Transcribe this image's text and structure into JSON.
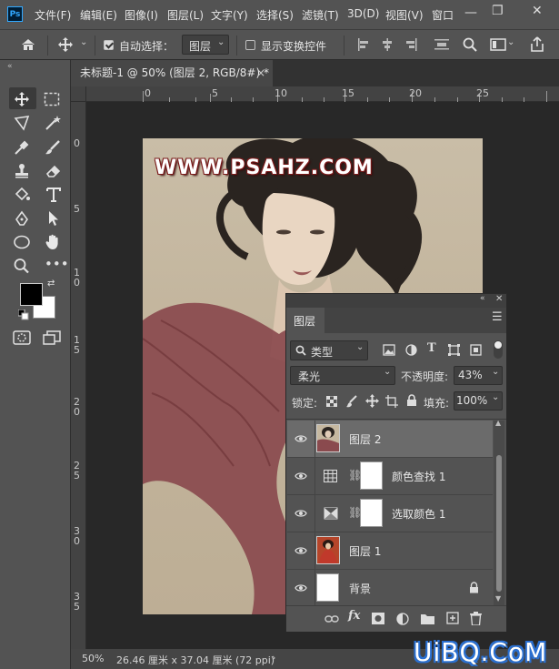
{
  "menubar": {
    "logo": "Ps",
    "items": [
      "文件(F)",
      "编辑(E)",
      "图像(I)",
      "图层(L)",
      "文字(Y)",
      "选择(S)",
      "滤镜(T)",
      "3D(D)",
      "视图(V)",
      "窗口"
    ]
  },
  "options": {
    "auto_select_label": "自动选择：",
    "auto_select_checked": true,
    "auto_select_target": "图层",
    "show_transform_label": "显示变换控件",
    "show_transform_checked": false
  },
  "tab": {
    "title": "未标题-1 @ 50% (图层 2, RGB/8#) *",
    "close": "×"
  },
  "rulers": {
    "top_ticks": [
      "0",
      "5",
      "10",
      "15",
      "20",
      "25"
    ],
    "left_ticks": [
      "0",
      "5",
      "10",
      "15",
      "20",
      "25",
      "30",
      "35"
    ]
  },
  "status": {
    "zoom": "50%",
    "doc_size": "26.46 厘米 x 37.04 厘米 (72 ppi)"
  },
  "canvas": {
    "watermark": "WWW.PSAHZ.COM"
  },
  "layers_panel": {
    "title": "图层",
    "filter_kind": "类型",
    "blend_mode": "柔光",
    "opacity_label": "不透明度:",
    "opacity_value": "43%",
    "lock_label": "锁定:",
    "fill_label": "填充:",
    "fill_value": "100%",
    "layers": [
      {
        "name": "图层 2",
        "selected": true,
        "type": "pixel"
      },
      {
        "name": "颜色查找 1",
        "selected": false,
        "type": "adjustment-lut"
      },
      {
        "name": "选取颜色 1",
        "selected": false,
        "type": "adjustment-selective"
      },
      {
        "name": "图层 1",
        "selected": false,
        "type": "pixel"
      },
      {
        "name": "背景",
        "selected": false,
        "type": "background",
        "locked": true
      }
    ]
  },
  "bottom_watermark": "UiBQ.CoM",
  "colors": {
    "ui_dark": "#282828",
    "ui_panel": "#535353",
    "selected_row": "#6b6b6b",
    "foreground": "#000000",
    "background": "#ffffff",
    "fabric": "#8a4a4e"
  }
}
